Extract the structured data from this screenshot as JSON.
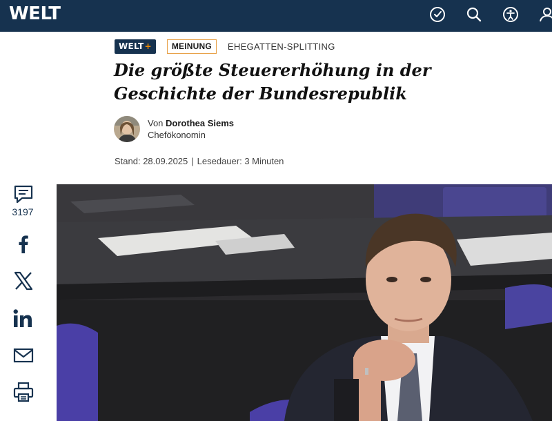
{
  "header": {
    "logo": "WELT",
    "icons": [
      "check-circle-icon",
      "search-icon",
      "accessibility-icon",
      "user-icon"
    ],
    "background_color": "#16324f"
  },
  "article": {
    "badge_plus": "WELT",
    "badge_plus_symbol": "+",
    "badge_opinion": "MEINUNG",
    "topic": "EHEGATTEN-SPLITTING",
    "headline": "Die größte Steuererhöhung in der Geschichte der Bundesrepublik",
    "author": {
      "prefix": "Von",
      "name": "Dorothea Siems",
      "role": "Chefökonomin"
    },
    "meta": {
      "date": "Stand: 28.09.2025",
      "separator": "|",
      "reading_time": "Lesedauer: 3 Minuten"
    }
  },
  "share_rail": {
    "comment_count": "3197",
    "icons": [
      "comment-icon",
      "facebook-icon",
      "x-icon",
      "linkedin-icon",
      "mail-icon",
      "print-icon"
    ]
  },
  "colors": {
    "brand_navy": "#16324f",
    "accent_orange": "#f08a00",
    "opinion_border": "#e8a24a"
  }
}
